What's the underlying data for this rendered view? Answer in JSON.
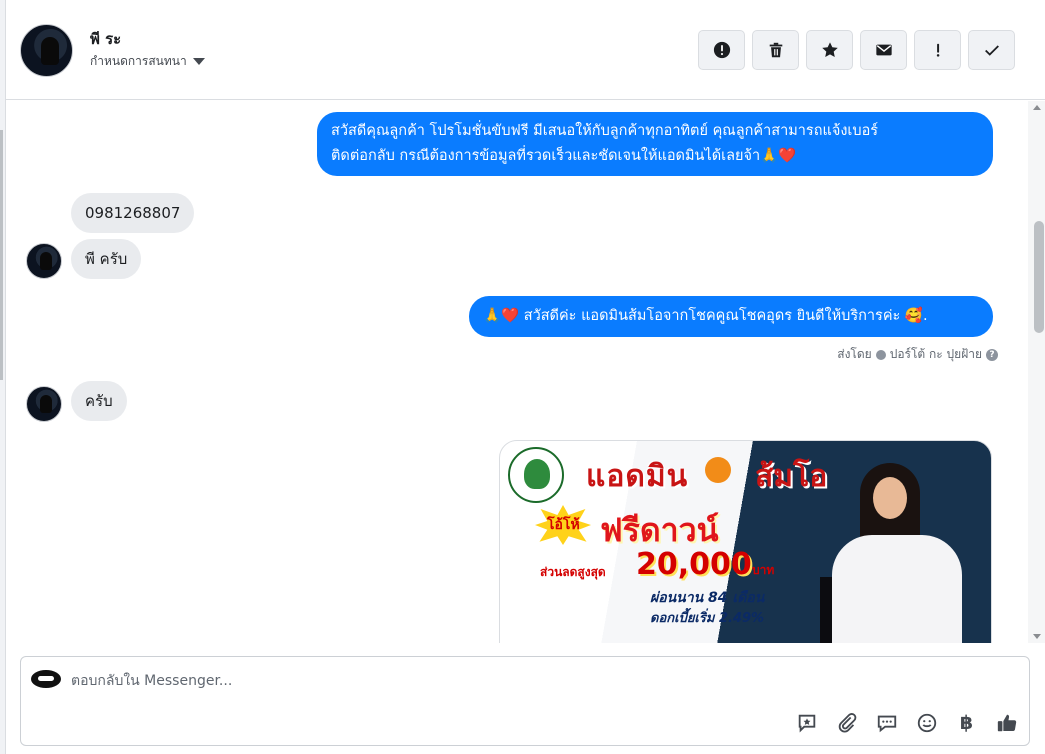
{
  "header": {
    "contact_name": "พี ระ",
    "assign_label": "กำหนดการสนทนา",
    "actions": [
      {
        "name": "report-icon",
        "label": "Report"
      },
      {
        "name": "trash-icon",
        "label": "Delete"
      },
      {
        "name": "star-icon",
        "label": "Star"
      },
      {
        "name": "envelope-icon",
        "label": "Mark unread"
      },
      {
        "name": "exclamation-icon",
        "label": "Spam"
      },
      {
        "name": "check-icon",
        "label": "Done"
      }
    ]
  },
  "messages": [
    {
      "from": "page",
      "text_line1": "สวัสดีคุณลูกค้า โปรโมชั่นขับฟรี มีเสนอให้กับลูกค้าทุกอาทิตย์ คุณลูกค้าสามารถแจ้งเบอร์",
      "text_line2": "ติดต่อกลับ กรณีต้องการข้อมูลที่รวดเร็วและชัดเจนให้แอดมินได้เลยจ้า🙏❤️"
    },
    {
      "from": "customer",
      "text": "0981268807"
    },
    {
      "from": "customer",
      "text": "พี ครับ"
    },
    {
      "from": "page",
      "text": "🙏❤️ สวัสดีค่ะ แอดมินส้มโอจากโชคคูณโชคอุดร ยินดีให้บริการค่ะ 🥰."
    },
    {
      "from": "customer",
      "text": "ครับ"
    }
  ],
  "sent_by": {
    "prefix": "ส่งโดย",
    "name": "ปอร์โต้ กะ ปุยฝ้าย"
  },
  "promo_image": {
    "headline_left": "แอดมิน",
    "headline_right": "ส้มโอ",
    "burst_label": "โอ้โห้",
    "free_down": "ฟรีดาวน์",
    "discount_label": "ส่วนลดสูงสุด",
    "discount_amount": "20,000",
    "discount_unit": "บาท",
    "installment": "ผ่อนนาน 84 เดือน",
    "interest": "ดอกเบี้ยเริ่ม 2.49%"
  },
  "composer": {
    "placeholder": "ตอบกลับใน Messenger...",
    "tools": [
      "saved-reply-icon",
      "attachment-icon",
      "chat-bubble-icon",
      "emoji-icon",
      "baht-icon",
      "thumbs-up-icon"
    ],
    "baht_symbol": "฿"
  },
  "colors": {
    "outgoing_bubble": "#0a7cff",
    "incoming_bubble": "#e9ebee",
    "border": "#dadde1"
  }
}
